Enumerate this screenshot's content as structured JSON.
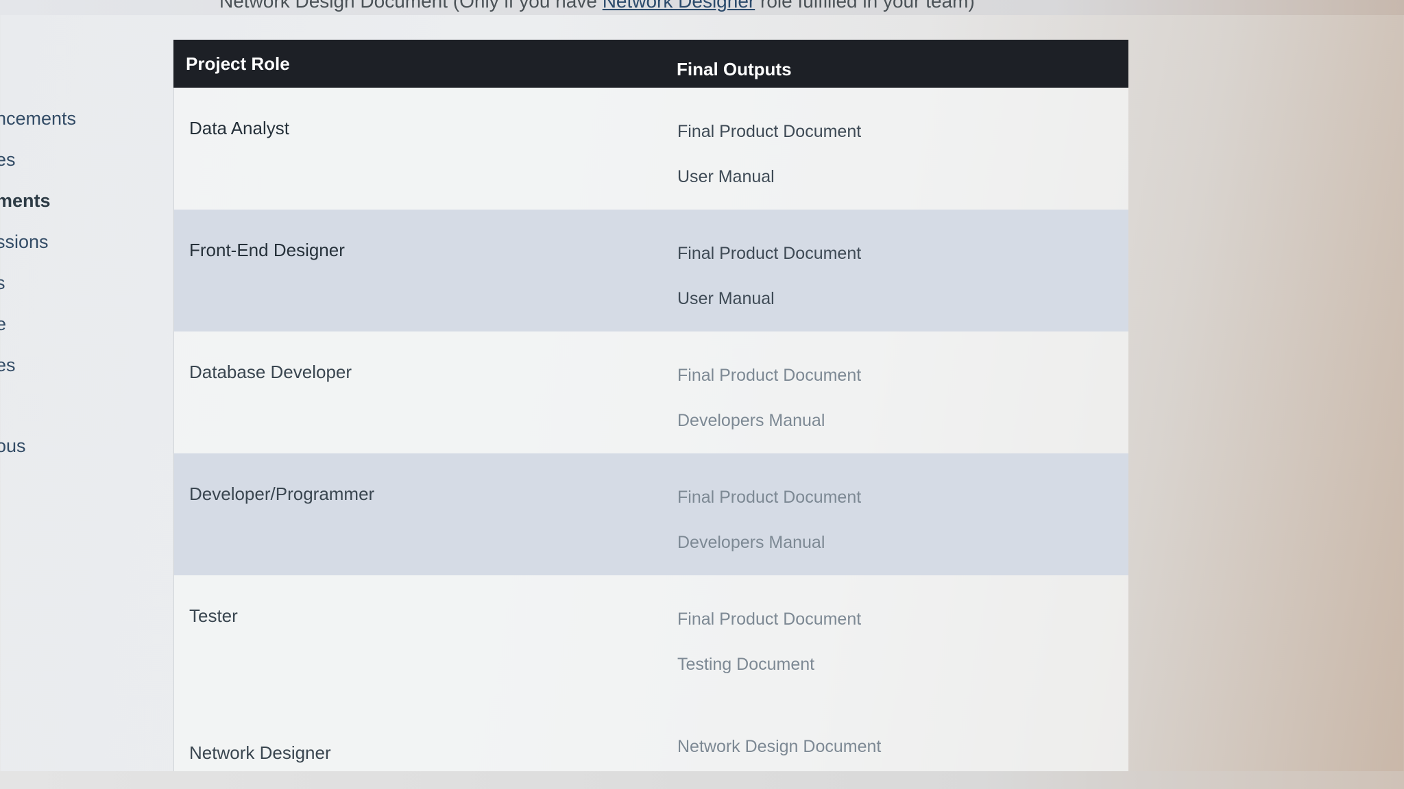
{
  "top_banner": {
    "text_before": "Network Design Document (Only if you have ",
    "link_text": "Network Designer",
    "text_after": " role fulfilled in your team)"
  },
  "sidebar": {
    "items": [
      {
        "label": "ncements",
        "active": false
      },
      {
        "label": "es",
        "active": false
      },
      {
        "label": "ments",
        "active": true
      },
      {
        "label": "ssions",
        "active": false
      },
      {
        "label": "s",
        "active": false
      },
      {
        "label": "e",
        "active": false
      },
      {
        "label": "es",
        "active": false
      },
      {
        "label": "ous",
        "active": false
      }
    ]
  },
  "table": {
    "headers": {
      "role": "Project Role",
      "outputs": "Final Outputs"
    },
    "rows": [
      {
        "role": "Data Analyst",
        "outputs": [
          "Final Product Document",
          "User Manual"
        ]
      },
      {
        "role": "Front-End Designer",
        "outputs": [
          "Final Product  Document",
          "User Manual"
        ]
      },
      {
        "role": "Database Developer",
        "outputs": [
          "Final Product  Document",
          "Developers Manual"
        ]
      },
      {
        "role": "Developer/Programmer",
        "outputs": [
          "Final Product  Document",
          "Developers Manual"
        ]
      },
      {
        "role": "Tester",
        "outputs": [
          "Final Product  Document",
          "Testing Document"
        ]
      },
      {
        "role": "Network Designer",
        "outputs": [
          "Network Design Document",
          ""
        ]
      }
    ]
  }
}
